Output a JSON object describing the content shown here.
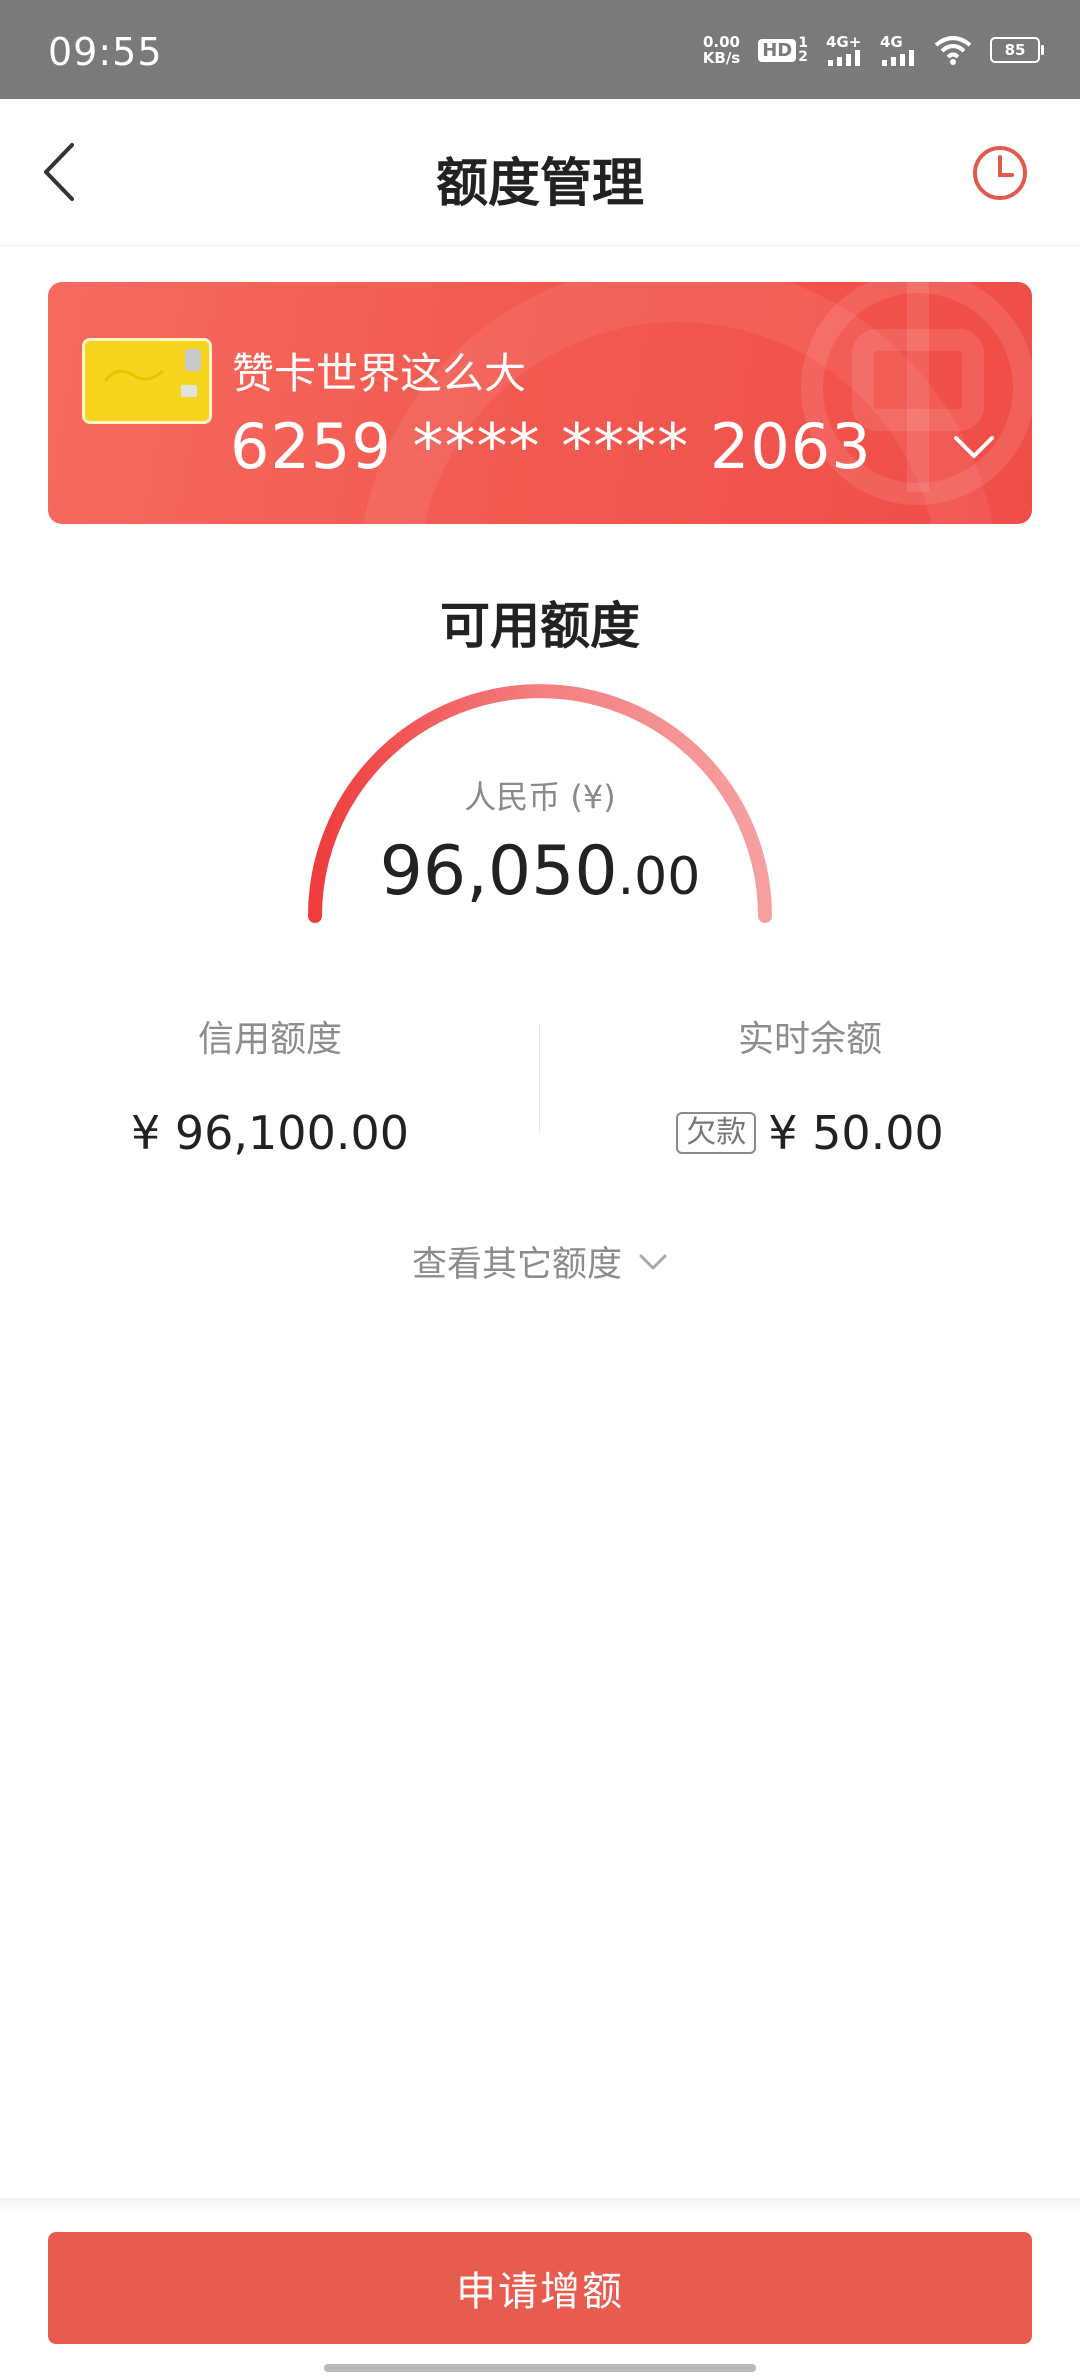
{
  "status_bar": {
    "time": "09:55",
    "net_speed_value": "0.00",
    "net_speed_unit": "KB/s",
    "hd_label": "HD",
    "hd_sim_top": "1",
    "hd_sim_bottom": "2",
    "signal1_label": "4G+",
    "signal2_label": "4G",
    "battery": "85",
    "icons": [
      "signal-icon",
      "wifi-icon",
      "battery-icon"
    ]
  },
  "nav": {
    "title": "额度管理",
    "back_icon": "back-arrow-icon",
    "history_icon": "clock-icon"
  },
  "card": {
    "name": "赞卡世界这么大",
    "number": "6259 **** **** 2063",
    "expand_icon": "chevron-down-icon"
  },
  "available": {
    "title": "可用额度",
    "currency": "人民币 (¥)",
    "amount_int": "96,050",
    "amount_dec": ".00",
    "gauge_fraction": 0.9995
  },
  "stats": {
    "credit_label": "信用额度",
    "credit_value": "¥ 96,100.00",
    "balance_label": "实时余额",
    "balance_tag": "欠款",
    "balance_value": "¥ 50.00"
  },
  "more_link": "查看其它额度",
  "apply_button": "申请增额",
  "colors": {
    "accent": "#E85B4F",
    "card_red": "#F25B51",
    "status_bar": "#7A7A7A"
  }
}
